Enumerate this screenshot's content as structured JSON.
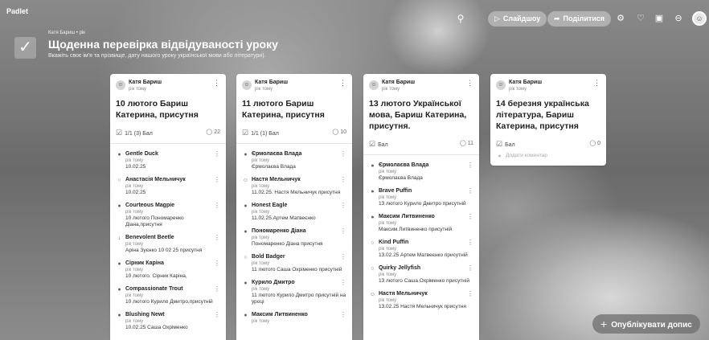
{
  "app": {
    "brand": "Padlet"
  },
  "toolbar": {
    "slideshow_label": "Слайдшоу",
    "share_label": "Поділитися",
    "icons": [
      "search-icon",
      "play-icon",
      "share-icon",
      "gear-icon",
      "bell-icon",
      "remake-icon",
      "more-icon"
    ]
  },
  "header": {
    "meta": "Катя Бариш • рік",
    "title": "Щоденна перевірка відвідуваності уроку",
    "subtitle": "Вкажіть своє ім'я та прізвище, дату нашого уроку української мови або літератури)."
  },
  "columns": [
    {
      "author": "Катя Бариш",
      "time": "рік тому",
      "title": "10 лютого Бариш Катерина, присутня",
      "stats": "1/1 (3)  Бал",
      "comment_count": "22",
      "comments": [
        {
          "name": "Gentle Duck",
          "time": "рік тому",
          "text": "10.02.25"
        },
        {
          "name": "Анастасія Мельничук",
          "time": "рік тому",
          "text": "10.02.25"
        },
        {
          "name": "Courteous Magpie",
          "time": "рік тому",
          "text": "10 лютого Пономаренко Діана,присутня"
        },
        {
          "name": "Benevolent Beetle",
          "time": "рік тому",
          "text": "Аріна Зуєнко 10 02 25 присутня"
        },
        {
          "name": "Сірник Каріна",
          "time": "рік тому",
          "text": "10 лютого. Сірник Каріна,"
        },
        {
          "name": "Compassionate Trout",
          "time": "рік тому",
          "text": "10 лютого Курило Дмитро,присутній"
        },
        {
          "name": "Blushing Newt",
          "time": "рік тому",
          "text": "10.02.25 Саша Охріменко"
        }
      ]
    },
    {
      "author": "Катя Бариш",
      "time": "рік тому",
      "title": "11 лютого Бариш Катерина, присутня",
      "stats": "1/1 (1)  Бал",
      "comment_count": "10",
      "comments": [
        {
          "name": "Єрмолаєва Влада",
          "time": "рік тому",
          "text": "Єрмолаєва Влада"
        },
        {
          "name": "Настя Мельничук",
          "time": "рік тому",
          "text": "11.02.25. Настя Мельничук присутня"
        },
        {
          "name": "Honest Eagle",
          "time": "рік тому",
          "text": "11.02.25.Артем Матвеєнко"
        },
        {
          "name": "Пономаренко Діана",
          "time": "рік тому",
          "text": "Пономаренко Діана присутня"
        },
        {
          "name": "Bold Badger",
          "time": "рік тому",
          "text": "11 лютого Саша Охріменко присутній"
        },
        {
          "name": "Курило Дмитро",
          "time": "рік тому",
          "text": "11 лютого Курило Дмитро присутній на уроці"
        },
        {
          "name": "Максим Литвиненко",
          "time": "рік тому",
          "text": ""
        }
      ]
    },
    {
      "author": "Катя Бариш",
      "time": "рік тому",
      "title": "13 лютого Української мова, Бариш Катерина, присутня.",
      "stats": "Бал",
      "comment_count": "11",
      "comments": [
        {
          "name": "Єрмолаєва Влада",
          "time": "рік тому",
          "text": "Єрмолаєва Влада"
        },
        {
          "name": "Brave Puffin",
          "time": "рік тому",
          "text": "13 лютого Курило Дмитро присутній"
        },
        {
          "name": "Максим Литвиненко",
          "time": "рік тому",
          "text": "Максим Литвиненко присутній"
        },
        {
          "name": "Kind Puffin",
          "time": "рік тому",
          "text": "13.02.25 Артем Матвеєнко присутній"
        },
        {
          "name": "Quirky Jellyfish",
          "time": "рік тому",
          "text": "13 лютого Саша Охріменко присутній"
        },
        {
          "name": "Настя Мельничук",
          "time": "рік тому",
          "text": "13.02.25 Настя Мельничук присутня"
        }
      ]
    },
    {
      "author": "Катя Бариш",
      "time": "рік тому",
      "title": "14 березня українська література, Бариш Катерина, присутня",
      "stats": "Бал",
      "comment_count": "0",
      "add_comment": "Додати коментар"
    }
  ],
  "publish_label": "Опублікувати допис"
}
